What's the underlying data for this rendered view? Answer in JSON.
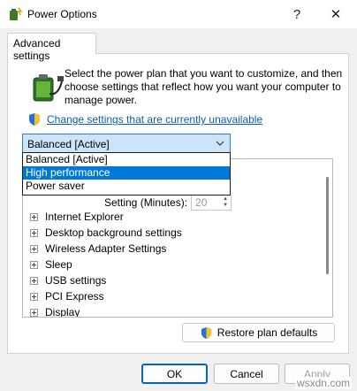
{
  "window": {
    "title": "Power Options",
    "help_glyph": "?",
    "close_glyph": "✕"
  },
  "tabs": [
    {
      "label": "Advanced settings"
    }
  ],
  "panel": {
    "description": "Select the power plan that you want to customize, and then choose settings that reflect how you want your computer to manage power.",
    "change_link": "Change settings that are currently unavailable",
    "plan_combo": {
      "selected": "Balanced [Active]",
      "options": [
        "Balanced [Active]",
        "High performance",
        "Power saver"
      ],
      "highlighted_index": 1
    },
    "setting_row": {
      "label": "Setting (Minutes):",
      "value": "20",
      "spin_up": "▲",
      "spin_down": "▼"
    },
    "tree_items": [
      "Internet Explorer",
      "Desktop background settings",
      "Wireless Adapter Settings",
      "Sleep",
      "USB settings",
      "PCI Express",
      "Display"
    ],
    "restore_button": "Restore plan defaults"
  },
  "footer": {
    "ok": "OK",
    "cancel": "Cancel",
    "apply": "Apply"
  },
  "watermark": "wsxdn.com",
  "colors": {
    "accent": "#0078d7",
    "link": "#0a5fb4",
    "combo_bg": "#cce4f7"
  }
}
